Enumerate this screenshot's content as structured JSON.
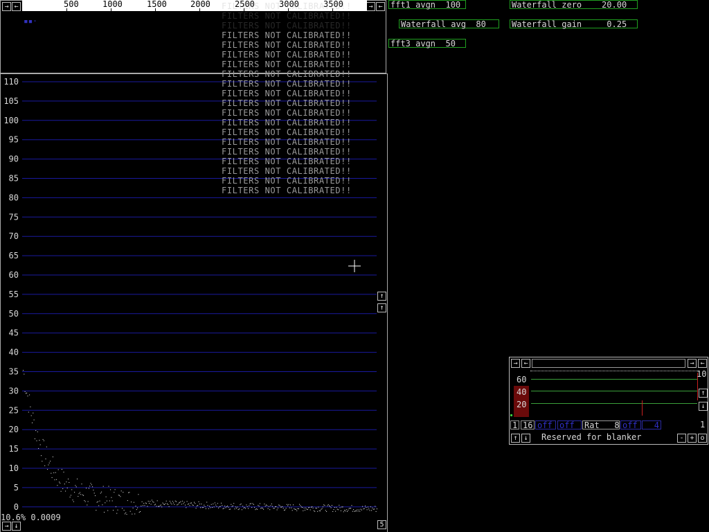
{
  "top_panel": {
    "freq_labels": [
      "500",
      "1000",
      "1500",
      "2000",
      "2500",
      "3000",
      "3500"
    ],
    "marker_text": "▪▪·",
    "filters_warning": "FILTERS NOT CALIBRATED!!",
    "filters_warning_repeat": 16
  },
  "spectrum": {
    "y_labels": [
      "110",
      "105",
      "100",
      "95",
      "90",
      "85",
      "80",
      "75",
      "70",
      "65",
      "60",
      "55",
      "50",
      "45",
      "40",
      "35",
      "30",
      "25",
      "20",
      "15",
      "10",
      "5",
      "0"
    ],
    "status_text": "10.6% 0.0009",
    "page_button": "5"
  },
  "params": {
    "fft1_avgn": "fft1 avgn  100",
    "waterfall_avg": "Waterfall avg  80",
    "fft3_avgn": "fft3 avgn  50",
    "waterfall_zero": "Waterfall zero    20.00",
    "waterfall_gain": "Waterfall gain     0.25"
  },
  "blanker": {
    "scale_labels": [
      "60",
      "40",
      "20"
    ],
    "right_value": "10",
    "field_1": "1",
    "field_16": "16",
    "field_off1": "off",
    "field_off2": "off",
    "field_rat": "Rat   8",
    "field_off3": "off",
    "field_4": "4",
    "count": "1",
    "title": "Reserved for blanker",
    "btn_minus": "-",
    "btn_plus": "+",
    "btn_o": "o"
  },
  "icons": {
    "left": "←",
    "right": "→",
    "up": "↑",
    "down": "↓"
  },
  "colors": {
    "grid": "#1a1aa0",
    "param_border": "#20a020",
    "blanker_bar": "#6a0a0a"
  }
}
